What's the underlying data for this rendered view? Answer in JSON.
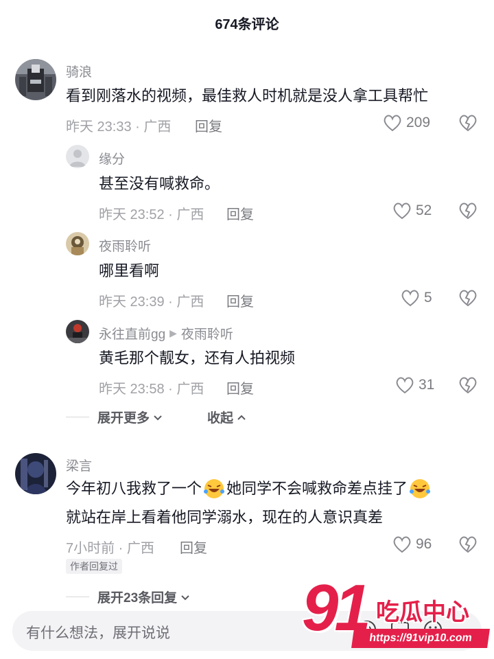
{
  "header": {
    "title": "674条评论"
  },
  "comments": [
    {
      "username": "骑浪",
      "text": "看到刚落水的视频，最佳救人时机就是没人拿工具帮忙",
      "meta": "昨天 23:33 · 广西",
      "reply_label": "回复",
      "likes": "209"
    },
    {
      "username": "缘分",
      "text": "甚至没有喊救命。",
      "meta": "昨天 23:52 · 广西",
      "reply_label": "回复",
      "likes": "52"
    },
    {
      "username": "夜雨聆听",
      "text": "哪里看啊",
      "meta": "昨天 23:39 · 广西",
      "reply_label": "回复",
      "likes": "5"
    },
    {
      "username": "永往直前gg",
      "reply_to": "夜雨聆听",
      "text": "黄毛那个靓女，还有人拍视频",
      "meta": "昨天 23:58 · 广西",
      "reply_label": "回复",
      "likes": "31"
    },
    {
      "username": "梁言",
      "text_line1": "今年初八我救了一个",
      "text_line1b": "她同学不会喊救命差点挂了",
      "text_line2": "就站在岸上看着他同学溺水，现在的人意识真差",
      "meta": "7小时前 · 广西",
      "reply_label": "回复",
      "likes": "96",
      "badge": "作者回复过"
    }
  ],
  "thread1": {
    "expand_more": "展开更多",
    "collapse": "收起"
  },
  "thread2": {
    "expand_replies": "展开23条回复"
  },
  "input": {
    "placeholder": "有什么想法，展开说说"
  },
  "watermark": {
    "number": "91",
    "brand": "吃瓜中心",
    "url": "https://91vip10.com"
  },
  "icons": {
    "like": "heart-outline-icon",
    "dislike": "broken-heart-icon",
    "expand": "chevron-down-icon",
    "collapse": "chevron-up-icon",
    "reply_arrow": "triangle-right-icon"
  },
  "colors": {
    "accent": "#e4204a",
    "meta": "#a0a1a6",
    "text": "#161823"
  }
}
